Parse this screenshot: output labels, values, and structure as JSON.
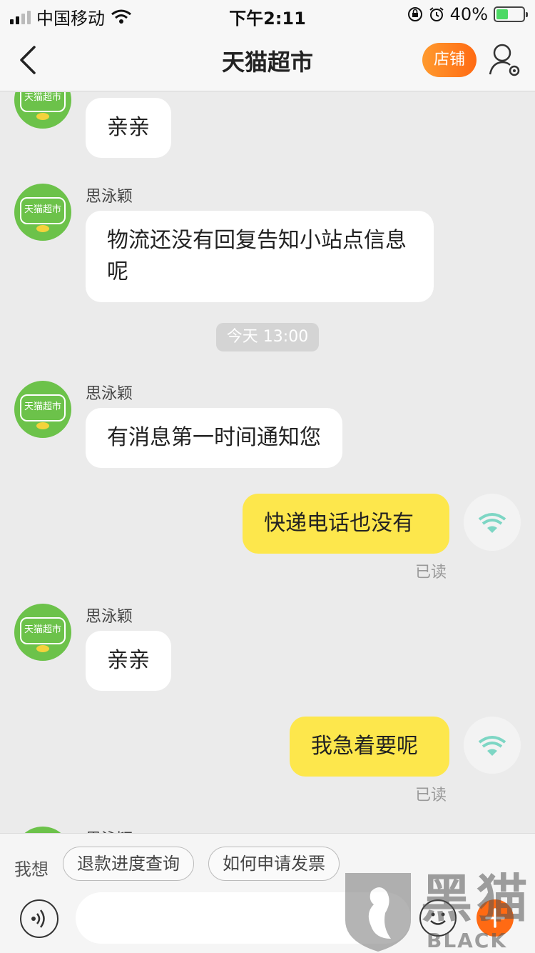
{
  "status_bar": {
    "carrier": "中国移动",
    "time": "下午2:11",
    "battery_percent": "40%",
    "battery_level": 0.4,
    "icons": [
      "signal-icon",
      "wifi-icon",
      "orientation-lock-icon",
      "alarm-icon",
      "battery-icon"
    ]
  },
  "nav": {
    "title": "天猫超市",
    "store_button": "店铺",
    "icons": [
      "back-chevron-icon",
      "user-settings-icon"
    ]
  },
  "chat": {
    "avatar_text": "天猫超市",
    "messages": [
      {
        "side": "left",
        "sender": "",
        "text": "亲亲"
      },
      {
        "side": "left",
        "sender": "思泳颖",
        "text": "物流还没有回复告知小站点信息呢"
      },
      {
        "side": "center",
        "time": "今天 13:00"
      },
      {
        "side": "left",
        "sender": "思泳颖",
        "text": "有消息第一时间通知您"
      },
      {
        "side": "right",
        "text": "快递电话也没有",
        "status": "已读"
      },
      {
        "side": "left",
        "sender": "思泳颖",
        "text": "亲亲"
      },
      {
        "side": "right",
        "text": "我急着要呢",
        "status": "已读"
      },
      {
        "side": "left",
        "sender": "思泳颖",
        "text": ""
      }
    ]
  },
  "bottom_bar": {
    "quick_label": "我想",
    "quick_replies": [
      "退款进度查询",
      "如何申请发票"
    ],
    "icons": [
      "voice-icon",
      "emoji-icon",
      "plus-icon"
    ]
  },
  "watermark": {
    "text": "黑猫",
    "sub": "BLACK CAT"
  }
}
